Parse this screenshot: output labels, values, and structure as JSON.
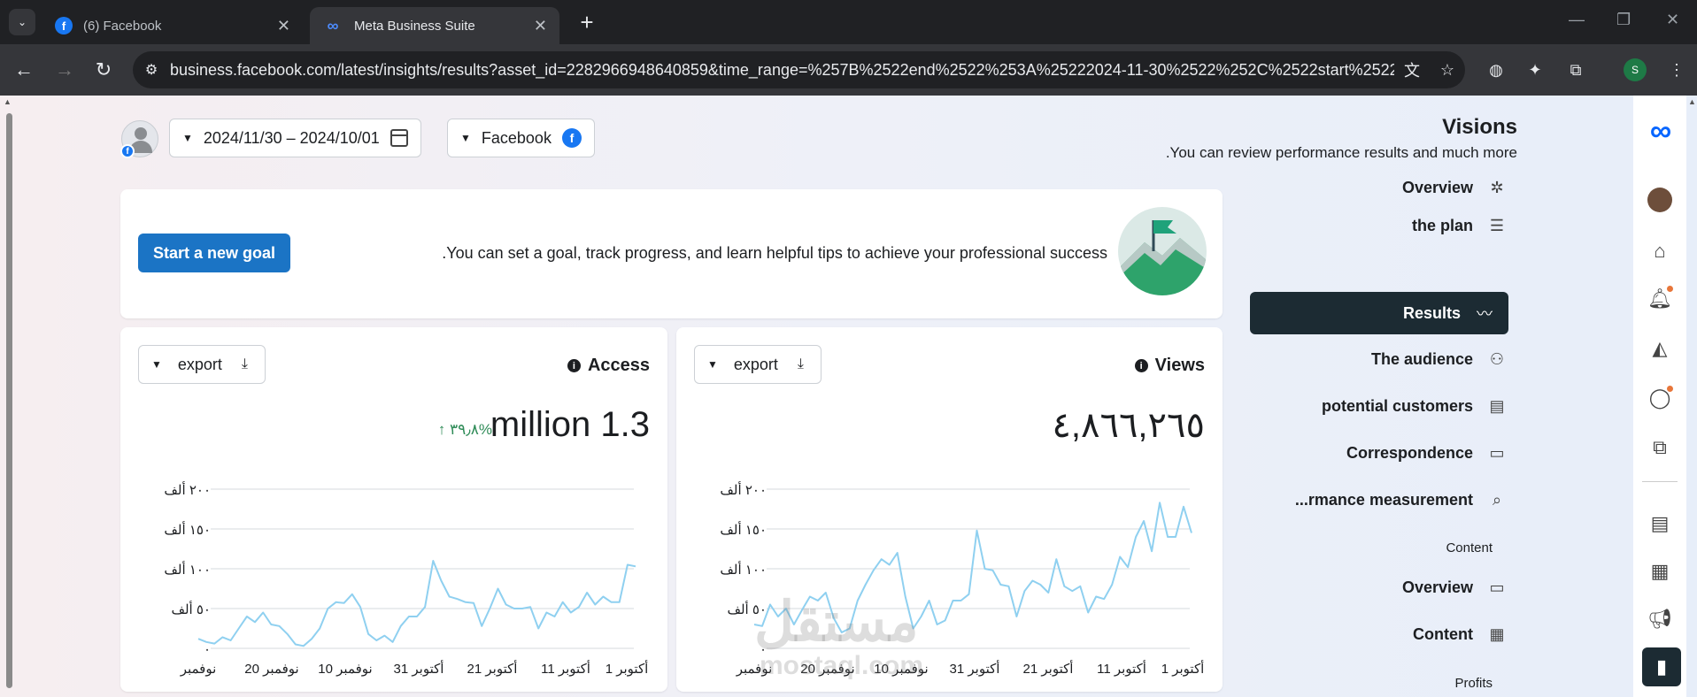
{
  "browser": {
    "tabs": [
      {
        "title": "(6) Facebook",
        "icon": "facebook-icon"
      },
      {
        "title": "Meta Business Suite",
        "icon": "meta-icon"
      }
    ],
    "url": "business.facebook.com/latest/insights/results?asset_id=2282966948640859&time_range=%257B%2522end%2522%253A%25222024-11-30%2522%252C%2522start%2522%25...",
    "profile_initial": "S"
  },
  "filters": {
    "date_range": "2024/11/30 – 2024/10/01",
    "platform": "Facebook"
  },
  "header": {
    "title": "Visions",
    "subtitle": ".You can review performance results and much more"
  },
  "goal": {
    "text": ".You can set a goal, track progress, and learn helpful tips to achieve your professional success",
    "button": "Start a new goal"
  },
  "export_label": "export",
  "metrics": {
    "access": {
      "title": "Access",
      "value": "million 1.3",
      "change": "٣٩٫٨%"
    },
    "views": {
      "title": "Views",
      "value": "٤,٨٦٦,٢٦٥"
    }
  },
  "nav": {
    "items": [
      {
        "label": "Overview",
        "icon": "network-icon"
      },
      {
        "label": "the plan",
        "icon": "list-icon"
      },
      {
        "label": "Results",
        "icon": "trend-icon",
        "active": true
      },
      {
        "label": "The audience",
        "icon": "people-icon"
      },
      {
        "label": "potential customers",
        "icon": "contact-card-icon"
      },
      {
        "label": "Correspondence",
        "icon": "messages-icon"
      },
      {
        "label": "...rmance measurement",
        "icon": "search-list-icon"
      }
    ],
    "content_section": "Content",
    "content_items": [
      {
        "label": "Overview",
        "icon": "messages-icon"
      },
      {
        "label": "Content",
        "icon": "table-icon"
      }
    ],
    "profits_section": "Profits"
  },
  "watermark": {
    "arabic": "مستقل",
    "latin": "mostaql.com"
  },
  "chart_data": [
    {
      "type": "line",
      "title": "Access",
      "color": "#8fd0f0",
      "ylim": [
        0,
        200000
      ],
      "yticks": [
        "٠",
        "٥٠ ألف",
        "١٠٠ ألف",
        "١٥٠ ألف",
        "٢٠٠ ألف"
      ],
      "xticks": [
        "1 أكتوبر",
        "11 أكتوبر",
        "21 أكتوبر",
        "31 أكتوبر",
        "10 نوفمبر",
        "20 نوفمبر",
        "نوفمبر"
      ],
      "values": [
        12000,
        8000,
        6000,
        14000,
        10000,
        25000,
        40000,
        33000,
        45000,
        30000,
        28000,
        18000,
        5000,
        3000,
        12000,
        25000,
        50000,
        58000,
        57000,
        68000,
        52000,
        18000,
        10000,
        16000,
        8000,
        28000,
        40000,
        40000,
        52000,
        110000,
        85000,
        65000,
        62000,
        58000,
        57000,
        28000,
        50000,
        75000,
        55000,
        50000,
        50000,
        52000,
        25000,
        45000,
        40000,
        58000,
        45000,
        52000,
        70000,
        55000,
        65000,
        58000,
        58000,
        105000,
        103000
      ]
    },
    {
      "type": "line",
      "title": "Views",
      "color": "#8fd0f0",
      "ylim": [
        0,
        200000
      ],
      "yticks": [
        "٠",
        "٥٠ ألف",
        "١٠٠ ألف",
        "١٥٠ ألف",
        "٢٠٠ ألف"
      ],
      "xticks": [
        "1 أكتوبر",
        "11 أكتوبر",
        "21 أكتوبر",
        "31 أكتوبر",
        "10 نوفمبر",
        "20 نوفمبر",
        "نوفمبر"
      ],
      "values": [
        30000,
        28000,
        55000,
        40000,
        50000,
        30000,
        48000,
        65000,
        60000,
        70000,
        38000,
        20000,
        25000,
        60000,
        80000,
        98000,
        112000,
        105000,
        120000,
        65000,
        25000,
        40000,
        60000,
        30000,
        35000,
        60000,
        60000,
        68000,
        148000,
        100000,
        98000,
        80000,
        78000,
        40000,
        72000,
        85000,
        80000,
        70000,
        112000,
        78000,
        72000,
        78000,
        45000,
        65000,
        62000,
        80000,
        115000,
        102000,
        140000,
        160000,
        122000,
        183000,
        140000,
        140000,
        178000,
        145000
      ]
    }
  ]
}
